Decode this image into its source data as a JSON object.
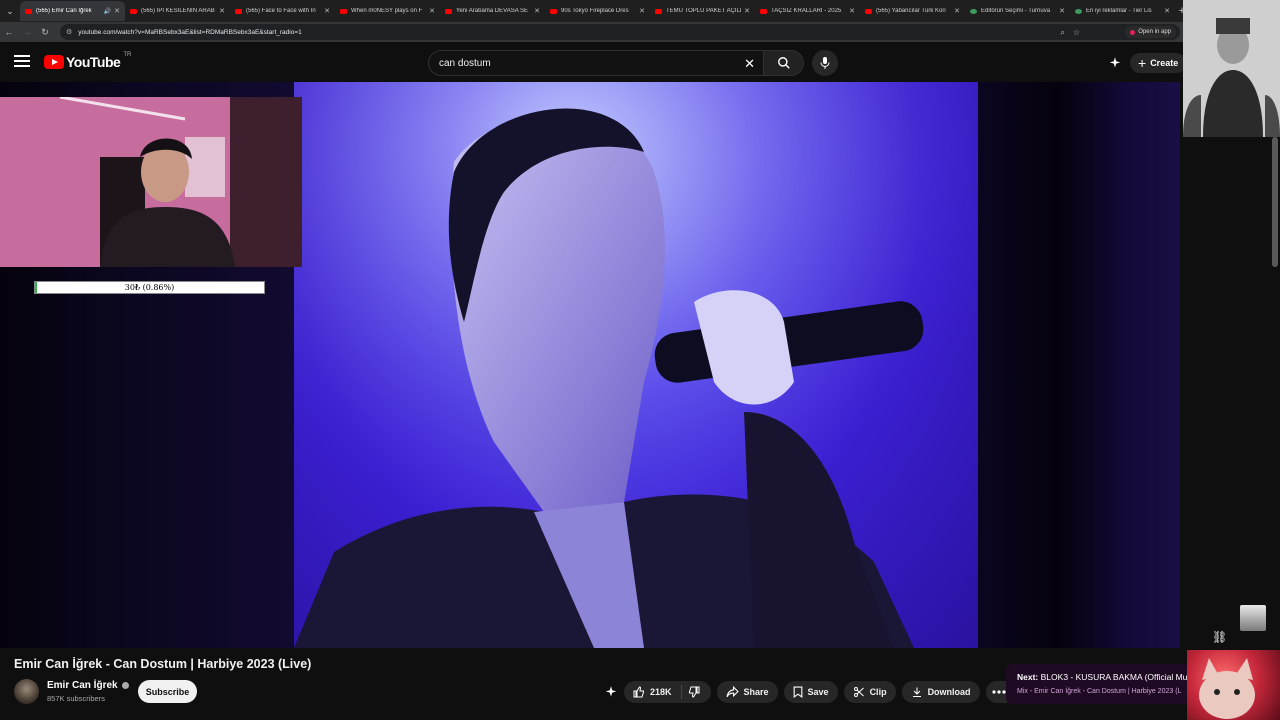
{
  "browser": {
    "tabs": [
      {
        "title": "(565) Emir Can İğrek",
        "active": true,
        "favicon": "youtube"
      },
      {
        "title": "(565) İPİ KESİLENİN ARAB",
        "favicon": "youtube"
      },
      {
        "title": "(565) Face to Face with In",
        "favicon": "youtube"
      },
      {
        "title": "When m0NESY plays on F",
        "favicon": "youtube"
      },
      {
        "title": "Yeni Arabama DEVASA SE",
        "favicon": "youtube"
      },
      {
        "title": "90s Tokyo Fireplace Dres",
        "favicon": "youtube"
      },
      {
        "title": "TEMU TOPLU PAKET AÇILI",
        "favicon": "youtube"
      },
      {
        "title": "TAÇSIZ KRALLARI - 2025",
        "favicon": "youtube"
      },
      {
        "title": "(565) Yabancılar Türk Kon",
        "favicon": "youtube"
      },
      {
        "title": "Editörün Seçimi - Turnuva",
        "favicon": "globe"
      },
      {
        "title": "En iyi reklamlar - Tier Lis",
        "favicon": "globe"
      }
    ],
    "url": "youtube.com/watch?v=MaRBSebx3aE&list=RDMaRBSebx3aE&start_radio=1",
    "open_in_app": "Open in app"
  },
  "youtube": {
    "logo_text": "YouTube",
    "region": "TR",
    "search_value": "can dostum",
    "create_label": "Create"
  },
  "overlay": {
    "progress_text": "30₺ (0.86%)",
    "progress_fraction": 0.0086
  },
  "video": {
    "title": "Emir Can İğrek - Can Dostum | Harbiye 2023 (Live)",
    "channel": "Emir Can İğrek",
    "subscribers": "857K subscribers",
    "subscribe_label": "Subscribe",
    "likes": "218K",
    "share_label": "Share",
    "save_label": "Save",
    "clip_label": "Clip",
    "download_label": "Download"
  },
  "next": {
    "prefix": "Next:",
    "title": "BLOK3 - KUSURA BAKMA (Official Mu",
    "subtitle": "Mix - Emir Can İğrek - Can Dostum | Harbiye 2023 (L"
  },
  "colors": {
    "accent": "#ff0000",
    "background": "#0f0f0f",
    "progress_fill": "#2db84d"
  }
}
